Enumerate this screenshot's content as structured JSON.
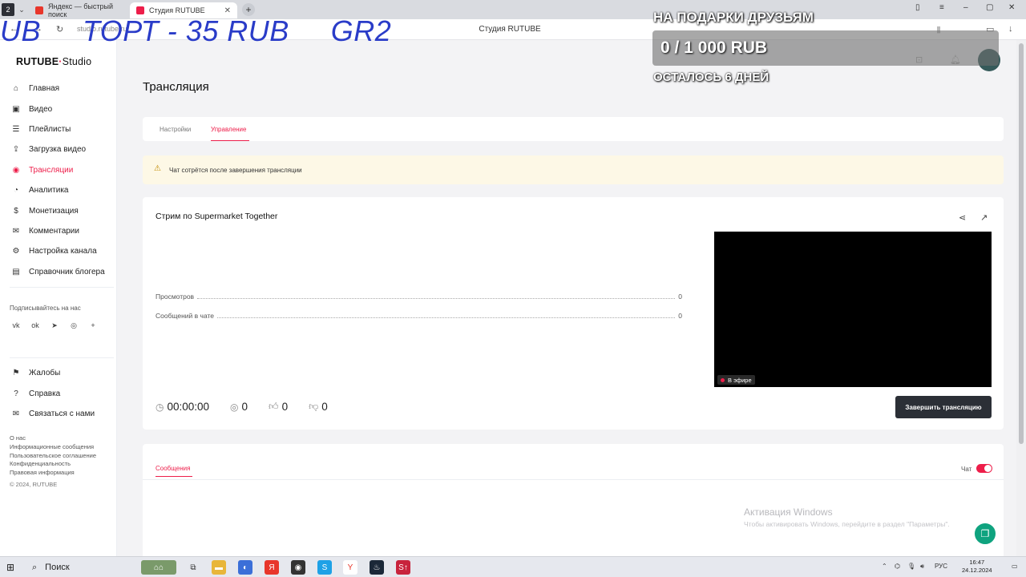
{
  "browser": {
    "tab_count_badge": "2",
    "tabs": [
      {
        "label": "Яндекс — быстрый поиск",
        "favicon_color": "#e8362b"
      },
      {
        "label": "Студия RUTUBE",
        "favicon_color": "#ed1e4a"
      }
    ],
    "page_title": "Студия RUTUBE",
    "url": "studio.rutube.ru",
    "tab_close": "✕",
    "new_tab": "+"
  },
  "overlay": {
    "scroll_text": [
      "UB",
      "ТОРТ - 35 RUB",
      "GR2"
    ],
    "donation_heading": "НА ПОДАРКИ ДРУЗЬЯМ",
    "donation_amount": "0 / 1 000 RUB",
    "donation_days_left": "ОСТАЛОСЬ 6 ДНЕЙ"
  },
  "sidebar": {
    "logo_main": "RUTUBE",
    "logo_dot": "·",
    "logo_studio": "Studio",
    "items": [
      {
        "label": "Главная",
        "icon": "home-icon",
        "glyph": "⌂"
      },
      {
        "label": "Видео",
        "icon": "video-icon",
        "glyph": "▣"
      },
      {
        "label": "Плейлисты",
        "icon": "playlist-icon",
        "glyph": "☰"
      },
      {
        "label": "Загрузка видео",
        "icon": "upload-icon",
        "glyph": "⇪"
      },
      {
        "label": "Трансляции",
        "icon": "broadcast-icon",
        "glyph": "◉"
      },
      {
        "label": "Аналитика",
        "icon": "analytics-icon",
        "glyph": "◔"
      },
      {
        "label": "Монетизация",
        "icon": "monetization-icon",
        "glyph": "$"
      },
      {
        "label": "Комментарии",
        "icon": "comments-icon",
        "glyph": "✉"
      },
      {
        "label": "Настройка канала",
        "icon": "settings-icon",
        "glyph": "⚙"
      },
      {
        "label": "Справочник блогера",
        "icon": "book-icon",
        "glyph": "▤"
      }
    ],
    "active_index": 4,
    "subscribe_label": "Подписывайтесь на нас",
    "socials": [
      {
        "icon": "vk-icon",
        "glyph": "vk"
      },
      {
        "icon": "ok-icon",
        "glyph": "ok"
      },
      {
        "icon": "telegram-icon",
        "glyph": "➤"
      },
      {
        "icon": "viber-icon",
        "glyph": "◎"
      },
      {
        "icon": "plus-icon",
        "glyph": "+"
      }
    ],
    "items2": [
      {
        "label": "Жалобы",
        "icon": "flag-icon",
        "glyph": "⚑"
      },
      {
        "label": "Справка",
        "icon": "help-icon",
        "glyph": "?"
      },
      {
        "label": "Связаться с нами",
        "icon": "mail-icon",
        "glyph": "✉"
      }
    ],
    "footer_links": [
      "О нас",
      "Информационные сообщения",
      "Пользовательское соглашение",
      "Конфиденциальность",
      "Правовая информация"
    ],
    "copyright": "© 2024, RUTUBE"
  },
  "main": {
    "title": "Трансляция",
    "tabs": [
      {
        "label": "Настройки",
        "active": false
      },
      {
        "label": "Управление",
        "active": true
      }
    ],
    "warning": "Чат сотрётся после завершения трансляции",
    "stream": {
      "title": "Стрим по Supermarket Together",
      "views_label": "Просмотров",
      "views_value": "0",
      "messages_label": "Сообщений в чате",
      "messages_value": "0",
      "live_badge": "В эфире",
      "duration": "00:00:00",
      "viewers": "0",
      "likes": "0",
      "dislikes": "0",
      "end_button": "Завершить трансляцию"
    },
    "chat": {
      "tab_label": "Сообщения",
      "toggle_label": "Чат",
      "toggle_on": true
    }
  },
  "windows": {
    "activation_title": "Активация Windows",
    "activation_sub": "Чтобы активировать Windows, перейдите в раздел \"Параметры\".",
    "search_label": "Поиск",
    "language": "РУС",
    "time": "16:47",
    "date": "24.12.2024"
  },
  "colors": {
    "accent": "#ed1e4a",
    "button_dark": "#2b2f36",
    "warning_bg": "#fdf8e6"
  }
}
